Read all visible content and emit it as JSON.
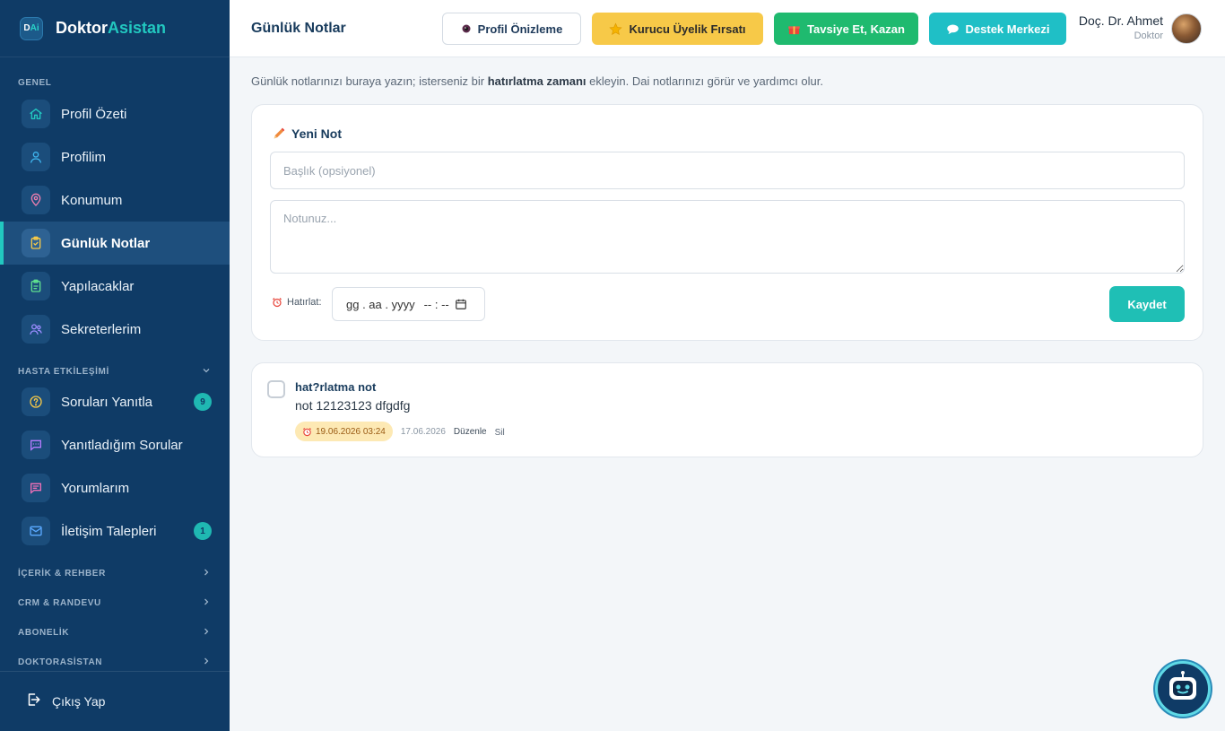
{
  "brand": {
    "logo_text_d": "D",
    "logo_text_ai": "Ai",
    "name_part1": "Doktor",
    "name_part2": "Asistan"
  },
  "sidebar": {
    "section_genel": "GENEL",
    "items_genel": [
      {
        "label": "Profil Özeti",
        "icon": "home-icon"
      },
      {
        "label": "Profilim",
        "icon": "user-icon"
      },
      {
        "label": "Konumum",
        "icon": "location-pin-icon"
      },
      {
        "label": "Günlük Notlar",
        "icon": "clipboard-check-icon",
        "active": true
      },
      {
        "label": "Yapılacaklar",
        "icon": "clipboard-list-icon"
      },
      {
        "label": "Sekreterlerim",
        "icon": "users-icon"
      }
    ],
    "section_hasta": "HASTA ETKİLEŞİMİ",
    "items_hasta": [
      {
        "label": "Soruları Yanıtla",
        "icon": "question-circle-icon",
        "badge": "9"
      },
      {
        "label": "Yanıtladığım Sorular",
        "icon": "chat-bubble-icon"
      },
      {
        "label": "Yorumlarım",
        "icon": "comment-icon"
      },
      {
        "label": "İletişim Talepleri",
        "icon": "mail-icon",
        "badge": "1"
      }
    ],
    "section_icerik": "İÇERİK & REHBER",
    "section_crm": "CRM & RANDEVU",
    "section_abone": "ABONELİK",
    "section_doktor": "DOKTORASİSTAN",
    "logout": "Çıkış Yap"
  },
  "header": {
    "title": "Günlük Notlar",
    "btn_profil": "Profil Önizleme",
    "btn_kurucu": "Kurucu Üyelik Fırsatı",
    "btn_tavsiye": "Tavsiye Et, Kazan",
    "btn_destek": "Destek Merkezi",
    "user_name": "Doç. Dr. Ahmet",
    "user_role": "Doktor"
  },
  "main": {
    "intro_part1": "Günlük notlarınızı buraya yazın; isterseniz bir ",
    "intro_bold": "hatırlatma zamanı",
    "intro_part2": " ekleyin. Dai notlarınızı görür ve yardımcı olur.",
    "new_note": {
      "title": "Yeni Not",
      "title_placeholder": "Başlık (opsiyonel)",
      "note_placeholder": "Notunuz...",
      "remind_label": "Hatırlat:",
      "date_placeholder": "gg . aa . yyyy",
      "time_placeholder": "-- : --",
      "save_label": "Kaydet"
    },
    "notes": [
      {
        "title": "hat?rlatma not",
        "body": "not 12123123 dfgdfg",
        "reminder": "19.06.2026 03:24",
        "created": "17.06.2026",
        "edit_label": "Düzenle",
        "delete_label": "Sil"
      }
    ]
  },
  "colors": {
    "sidebar_bg": "#0f3b66",
    "accent": "#22c8c0",
    "kurucu": "#f7c948",
    "tavsiye": "#1fba6f",
    "destek": "#1fbfc6"
  }
}
